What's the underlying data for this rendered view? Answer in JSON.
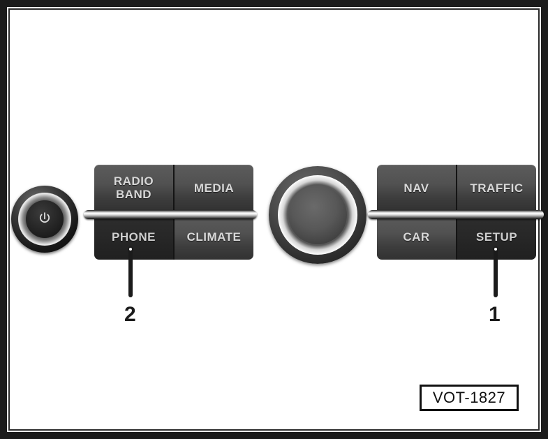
{
  "figure": {
    "id_label": "VOT-1827",
    "frame_color": "#1b1b1b",
    "background_color": "#ffffff"
  },
  "power_knob": {
    "name": "power-volume-knob",
    "icon": "power-symbol-icon",
    "ring_color": "#e8e8e8",
    "body_color": "#1d1d1d"
  },
  "center_knob": {
    "name": "rotary-selector-knob",
    "ring_color": "#fbfbfb",
    "body_color": "#585858"
  },
  "left_group": {
    "name": "left-button-cluster",
    "callout": "2",
    "trim_color": "#e3e3e3",
    "buttons": [
      {
        "label": "RADIO\nBAND",
        "name": "radio-band-button",
        "highlighted": false
      },
      {
        "label": "MEDIA",
        "name": "media-button",
        "highlighted": false
      },
      {
        "label": "PHONE",
        "name": "phone-button",
        "highlighted": true
      },
      {
        "label": "CLIMATE",
        "name": "climate-button",
        "highlighted": false
      }
    ]
  },
  "right_group": {
    "name": "right-button-cluster",
    "callout": "1",
    "trim_color": "#e3e3e3",
    "buttons": [
      {
        "label": "NAV",
        "name": "nav-button",
        "highlighted": false
      },
      {
        "label": "TRAFFIC",
        "name": "traffic-button",
        "highlighted": false
      },
      {
        "label": "CAR",
        "name": "car-button",
        "highlighted": false
      },
      {
        "label": "SETUP",
        "name": "setup-button",
        "highlighted": true
      }
    ]
  }
}
